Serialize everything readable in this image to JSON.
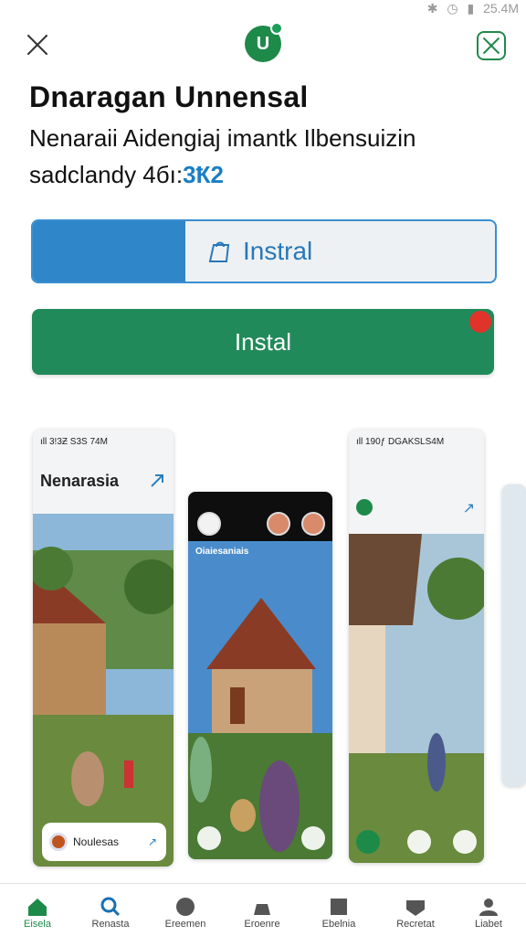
{
  "status_bar": {
    "icons": [
      "bluetooth-icon",
      "alarm-icon",
      "signal-icon",
      "battery-icon"
    ],
    "time": "25.4M"
  },
  "header": {
    "logo_letter": "U"
  },
  "app": {
    "title": "Dnaragan Unnensal",
    "subtitle": "Nenaraii Aidengiaj imantk Ilbensuizin",
    "meta_prefix": "sadclandy 4бı:",
    "meta_highlight": "3Ҟ2"
  },
  "install_bar": {
    "label": "Instral",
    "progress": 0.33
  },
  "install_button": {
    "label": "Instal"
  },
  "screenshots": [
    {
      "status": "ıll 3!3Ƶ S3S 74M",
      "title": "Nenarasia",
      "card_text": "Noulesas"
    },
    {
      "caption": "Oiaiesaniais"
    },
    {
      "status": "ıll 190ƒ DGAKSLS4M"
    }
  ],
  "bottom_nav": [
    {
      "label": "Eisela"
    },
    {
      "label": "Renasta"
    },
    {
      "label": "Ereemen"
    },
    {
      "label": "Eroenre"
    },
    {
      "label": "Ebelnia"
    },
    {
      "label": "Recretat"
    },
    {
      "label": "Liabet"
    }
  ],
  "colors": {
    "accent": "#218a5a",
    "blue": "#2f86c9",
    "badge": "#e0332a"
  }
}
